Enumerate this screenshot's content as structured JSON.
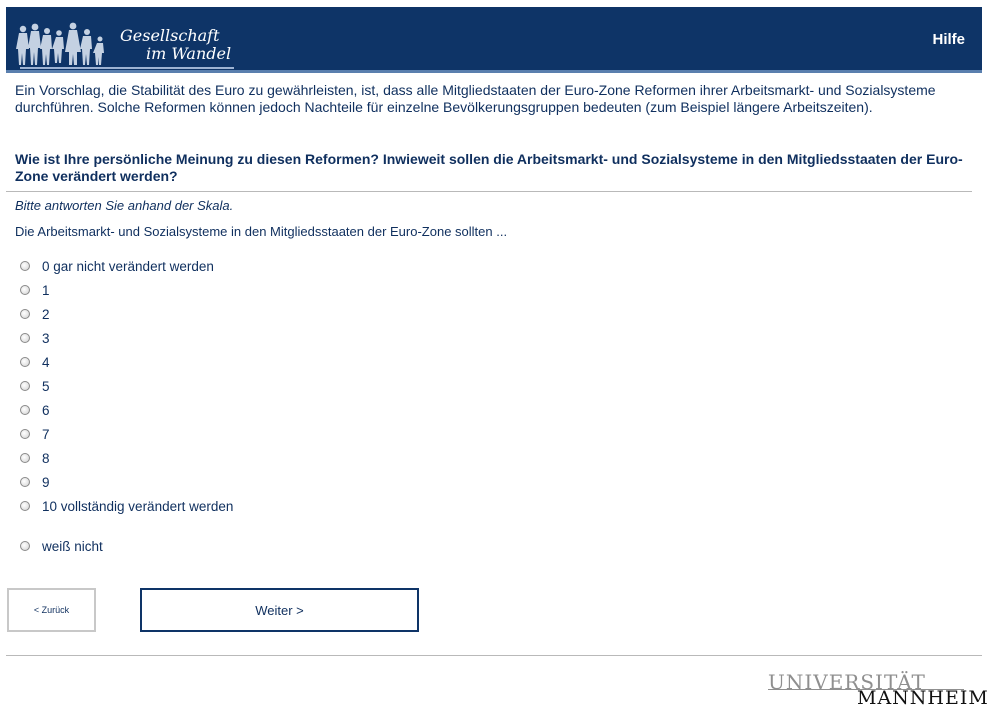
{
  "header": {
    "logo_line1": "Gesellschaft",
    "logo_line2": "im Wandel",
    "help_label": "Hilfe",
    "bg_color": "#0e3467"
  },
  "intro_text": "Ein Vorschlag, die Stabilität des Euro zu gewährleisten, ist, dass alle Mitgliedstaaten der Euro-Zone Reformen ihrer Arbeitsmarkt- und Sozialsysteme durchführen. Solche Reformen können jedoch Nachteile für einzelne Bevölkerungsgruppen bedeuten (zum Beispiel längere Arbeitszeiten).",
  "question": "Wie ist Ihre persönliche Meinung zu diesen Reformen? Inwieweit sollen die Arbeitsmarkt- und Sozialsysteme in den Mitgliedsstaaten der Euro-Zone verändert werden?",
  "instruction": "Bitte antworten Sie anhand der Skala.",
  "stem": "Die Arbeitsmarkt- und Sozialsysteme in den Mitgliedsstaaten der Euro-Zone sollten ...",
  "options": [
    {
      "label": "0 gar nicht verändert werden"
    },
    {
      "label": "1"
    },
    {
      "label": "2"
    },
    {
      "label": "3"
    },
    {
      "label": "4"
    },
    {
      "label": "5"
    },
    {
      "label": "6"
    },
    {
      "label": "7"
    },
    {
      "label": "8"
    },
    {
      "label": "9"
    },
    {
      "label": "10 vollständig verändert werden"
    },
    {
      "label": "weiß nicht"
    }
  ],
  "nav": {
    "back_label": "< Zurück",
    "next_label": "Weiter >"
  },
  "footer": {
    "university_line1": "UNIVERSITÄT",
    "university_line2": "MANNHEIM"
  }
}
